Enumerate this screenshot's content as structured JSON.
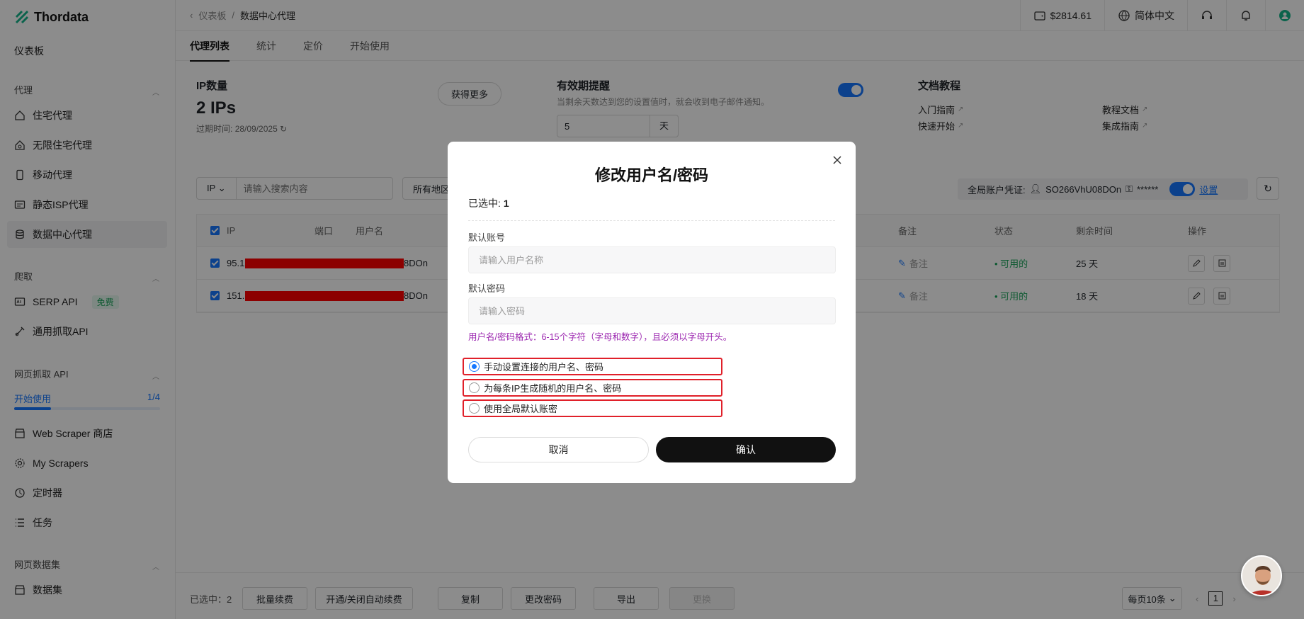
{
  "app": {
    "logo_text": "Thordata"
  },
  "sidebar": {
    "dashboard": "仪表板",
    "sections": {
      "proxy": "代理",
      "crawl": "爬取",
      "webscrape": "网页抓取 API",
      "dataset": "网页数据集"
    },
    "proxy_items": [
      "住宅代理",
      "无限住宅代理",
      "移动代理",
      "静态ISP代理",
      "数据中心代理"
    ],
    "crawl_items": [
      "SERP API",
      "通用抓取API"
    ],
    "free_badge": "免费",
    "start_label": "开始使用",
    "start_progress_text": "1/4",
    "start_progress": 0.25,
    "webscrape_items": [
      "Web Scraper 商店",
      "My Scrapers",
      "定时器",
      "任务"
    ],
    "dataset_items": [
      "数据集"
    ]
  },
  "topbar": {
    "breadcrumb_parent": "仪表板",
    "breadcrumb_sep": "/",
    "breadcrumb_current": "数据中心代理",
    "balance": "$2814.61",
    "language": "简体中文"
  },
  "tabs": [
    "代理列表",
    "统计",
    "定价",
    "开始使用"
  ],
  "ip_card": {
    "title": "IP数量",
    "count": "2 IPs",
    "expiry_label": "过期时间:",
    "expiry_date": "28/09/2025",
    "get_more": "获得更多"
  },
  "expiry_card": {
    "title": "有效期提醒",
    "desc": "当剩余天数达到您的设置值时，就会收到电子邮件通知。",
    "days_value": "5",
    "days_unit": "天"
  },
  "docs_card": {
    "title": "文档教程",
    "links": [
      "入门指南",
      "教程文档",
      "快速开始",
      "集成指南"
    ]
  },
  "filters": {
    "ip_select": "IP",
    "search_placeholder": "请输入搜索内容",
    "region_select": "所有地区"
  },
  "credentials": {
    "label": "全局账户凭证:",
    "username": "SO266VhU08DOn",
    "password": "******",
    "settings_link": "设置"
  },
  "table": {
    "columns": [
      "IP",
      "端口",
      "用户名",
      "备注",
      "状态",
      "剩余时间",
      "操作"
    ],
    "rows": [
      {
        "ip": "95.1",
        "username_tail": "8DOn",
        "remark": "备注",
        "status": "• 可用的",
        "remaining": "25 天"
      },
      {
        "ip": "151.",
        "username_tail": "8DOn",
        "remark": "备注",
        "status": "• 可用的",
        "remaining": "18 天"
      }
    ]
  },
  "bottombar": {
    "selected_text": "已选中：2",
    "buttons": [
      "批量续费",
      "开通/关闭自动续费",
      "复制",
      "更改密码",
      "导出",
      "更换"
    ],
    "page_size": "每页10条",
    "current_page": "1"
  },
  "modal": {
    "title": "修改用户名/密码",
    "selected_label": "已选中:",
    "selected_count": "1",
    "username_label": "默认账号",
    "username_placeholder": "请输入用户名称",
    "password_label": "默认密码",
    "password_placeholder": "请输入密码",
    "hint": "用户名/密码格式：6-15个字符（字母和数字），且必须以字母开头。",
    "options": [
      "手动设置连接的用户名、密码",
      "为每条IP生成随机的用户名、密码",
      "使用全局默认账密"
    ],
    "selected_option": 0,
    "cancel": "取消",
    "confirm": "确认"
  },
  "colors": {
    "accent": "#1677ff",
    "success": "#19a35a",
    "hint": "#9c27b0",
    "highlight": "#e0202a"
  }
}
